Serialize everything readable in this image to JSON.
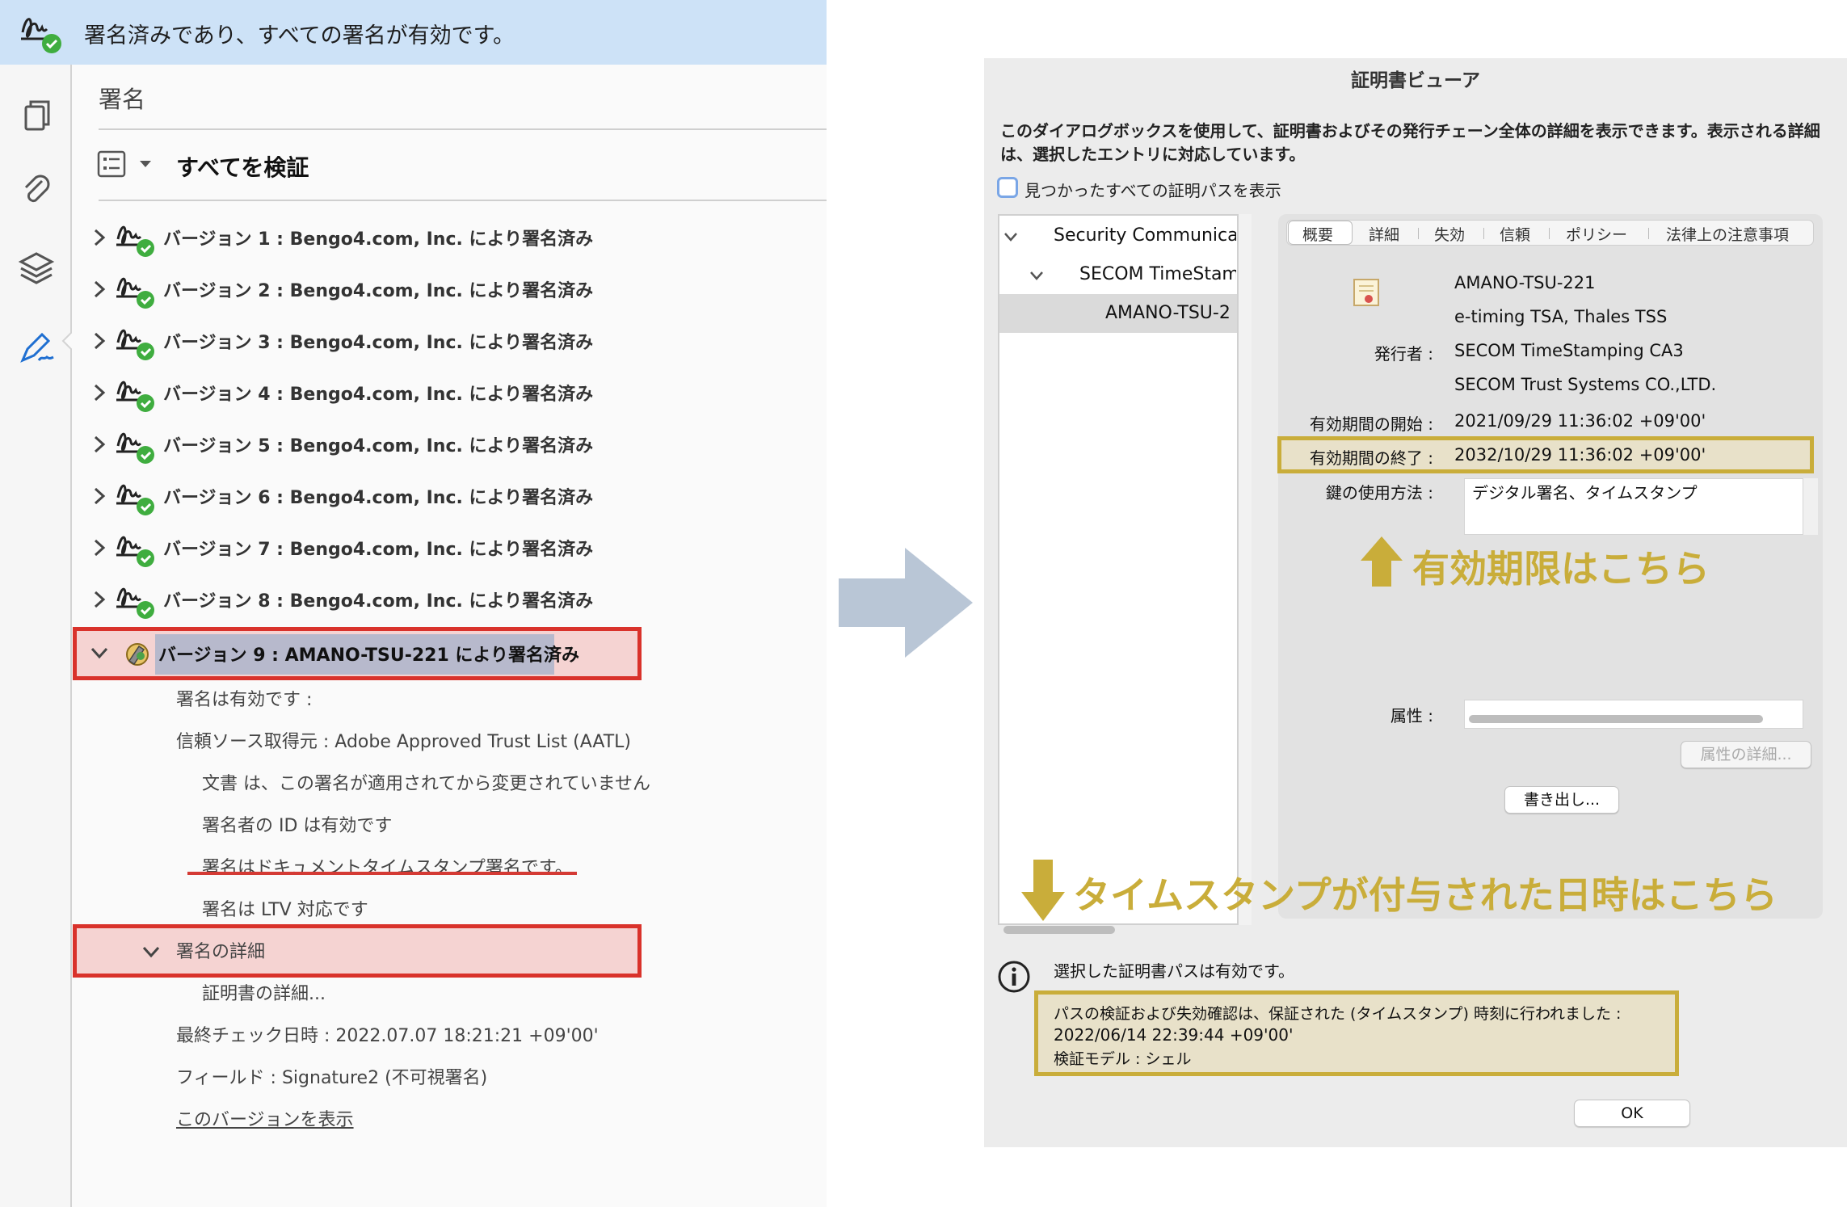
{
  "banner": {
    "text": "署名済みであり、すべての署名が有効です。"
  },
  "left_panel": {
    "title": "署名",
    "verify_all": "すべてを検証",
    "versions": [
      "バージョン 1 : Bengo4.com, Inc. により署名済み",
      "バージョン 2 : Bengo4.com, Inc. により署名済み",
      "バージョン 3 : Bengo4.com, Inc. により署名済み",
      "バージョン 4 : Bengo4.com, Inc. により署名済み",
      "バージョン 5 : Bengo4.com, Inc. により署名済み",
      "バージョン 6 : Bengo4.com, Inc. により署名済み",
      "バージョン 7 : Bengo4.com, Inc. により署名済み",
      "バージョン 8 : Bengo4.com, Inc. により署名済み"
    ],
    "version9": "バージョン 9 : AMANO-TSU-221 により署名済み",
    "details": {
      "valid": "署名は有効です :",
      "trust_source": "信頼ソース取得元 : Adobe Approved Trust List (AATL)",
      "unchanged": "文書 は、この署名が適用されてから変更されていません",
      "id_valid": "署名者の ID は有効です",
      "timestamp": "署名はドキュメントタイムスタンプ署名です。",
      "ltv": "署名は LTV 対応です",
      "sig_details": "署名の詳細",
      "cert_details": "証明書の詳細...",
      "last_check": "最終チェック日時 : 2022.07.07 18:21:21 +09'00'",
      "field": "フィールド : Signature2 (不可視署名)",
      "show_version": "このバージョンを表示"
    }
  },
  "dialog": {
    "title": "証明書ビューア",
    "description": "このダイアログボックスを使用して、証明書およびその発行チェーン全体の詳細を表示できます。表示される詳細は、選択したエントリに対応しています。",
    "show_all_paths": "見つかったすべての証明パスを表示",
    "tree": [
      "Security Communicat",
      "SECOM TimeStamp",
      "AMANO-TSU-2"
    ],
    "tabs": [
      "概要",
      "詳細",
      "失効",
      "信頼",
      "ポリシー",
      "法律上の注意事項"
    ],
    "subject_name": "AMANO-TSU-221",
    "subject_org": "e-timing TSA, Thales TSS",
    "issuer_label": "発行者 :",
    "issuer_name": "SECOM TimeStamping CA3",
    "issuer_org": "SECOM Trust Systems CO.,LTD.",
    "valid_from_label": "有効期間の開始 :",
    "valid_from": "2021/09/29 11:36:02 +09'00'",
    "valid_to_label": "有効期間の終了 :",
    "valid_to": "2032/10/29 11:36:02 +09'00'",
    "key_usage_label": "鍵の使用方法 :",
    "key_usage": "デジタル署名、タイムスタンプ",
    "attributes_label": "属性 :",
    "attr_details_button": "属性の詳細...",
    "export_button": "書き出し...",
    "path_valid": "選択した証明書パスは有効です。",
    "validation_line1": "パスの検証および失効確認は、保証された (タイムスタンプ) 時刻に行われました :",
    "validation_line2": "2022/06/14 22:39:44 +09'00'",
    "validation_line3": "検証モデル : シェル",
    "ok_button": "OK"
  },
  "annotations": {
    "expiry": "有効期限はこちら",
    "timestamp": "タイムスタンプが付与された日時はこちら",
    "color": "#c9ad3a"
  },
  "colors": {
    "banner": "#cde2f7",
    "red_box": "#d9322b",
    "gold": "#c9ad3a",
    "arrow": "#b9c6d6",
    "valid_green": "#3fad3f"
  }
}
